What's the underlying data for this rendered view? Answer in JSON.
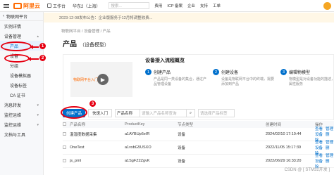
{
  "topbar": {
    "logo": "阿里云",
    "workbench": "工作台",
    "region": "华东2（上海）",
    "search_placeholder": "搜索...",
    "links": [
      "费用",
      "ICP 备案",
      "企业",
      "支持",
      "工单"
    ]
  },
  "notice": "2023-12-08发布公告：企业版服务于12月将调整收费...",
  "sidebar": {
    "title": "物联网平台",
    "items": [
      {
        "label": "实例详情",
        "type": "top"
      },
      {
        "label": "设备管理",
        "type": "group"
      },
      {
        "label": "产品",
        "type": "sub",
        "active": true
      },
      {
        "label": "设备",
        "type": "sub"
      },
      {
        "label": "分组",
        "type": "sub"
      },
      {
        "label": "设备模拟器",
        "type": "sub"
      },
      {
        "label": "设备标签",
        "type": "sub"
      },
      {
        "label": "CA 证书",
        "type": "sub"
      },
      {
        "label": "消息转发",
        "type": "group"
      },
      {
        "label": "监控运维",
        "type": "group"
      },
      {
        "label": "监控运维",
        "type": "group"
      },
      {
        "label": "文档与工具",
        "type": "top"
      }
    ]
  },
  "breadcrumb": "物联网平台 / 设备管理 / 产品",
  "page": {
    "title": "产品",
    "subtitle": "（设备模型）"
  },
  "flow": {
    "title": "设备接入流程概览",
    "video_text": "物联网平台入门视频",
    "steps": [
      {
        "num": "1",
        "title": "创建产品",
        "desc": "产品是同一类设备的集合，通过产品管理设备"
      },
      {
        "num": "2",
        "title": "创建设备",
        "desc": "设备是物联网平台中的终端，需要添加到产品"
      },
      {
        "num": "3",
        "title": "编辑物模型",
        "desc": "物模型是对设备功能的描述，包括属性服务"
      }
    ]
  },
  "toolbar": {
    "create_product": "创建产品",
    "quick_entry": "快速入门",
    "select_value": "产品名称",
    "search_placeholder": "请输入产品名称查询",
    "filter_placeholder": "请选择产品标签"
  },
  "table": {
    "headers": [
      "产品名称",
      "ProductKey",
      "节点类型",
      "",
      "创建时间",
      "操作"
    ],
    "rows": [
      {
        "name": "温湿度数据采集",
        "key": "a1AYBUp6eIR",
        "node": "设备",
        "time": "2024/02/10 17:10:44",
        "actions": [
          "查看",
          "管理设备",
          "删除"
        ]
      },
      {
        "name": "OneTest",
        "key": "a1vxbG5USXO",
        "node": "设备",
        "time": "2022/11/05 15:17:39",
        "actions": [
          "查看",
          "管理设备",
          "删除"
        ]
      },
      {
        "name": "js_pml",
        "key": "a1SgFZ2ZgvK",
        "node": "设备",
        "time": "2022/06/29 16:33:20",
        "actions": [
          "查看",
          "管理设备",
          "删除"
        ]
      }
    ]
  },
  "annotations": [
    "1",
    "2",
    "3"
  ],
  "watermark": "CSDN @ [ STM32开发 ]",
  "colors": {
    "brand": "#ff6a00",
    "primary": "#0070cc",
    "annotation": "#e60012"
  }
}
